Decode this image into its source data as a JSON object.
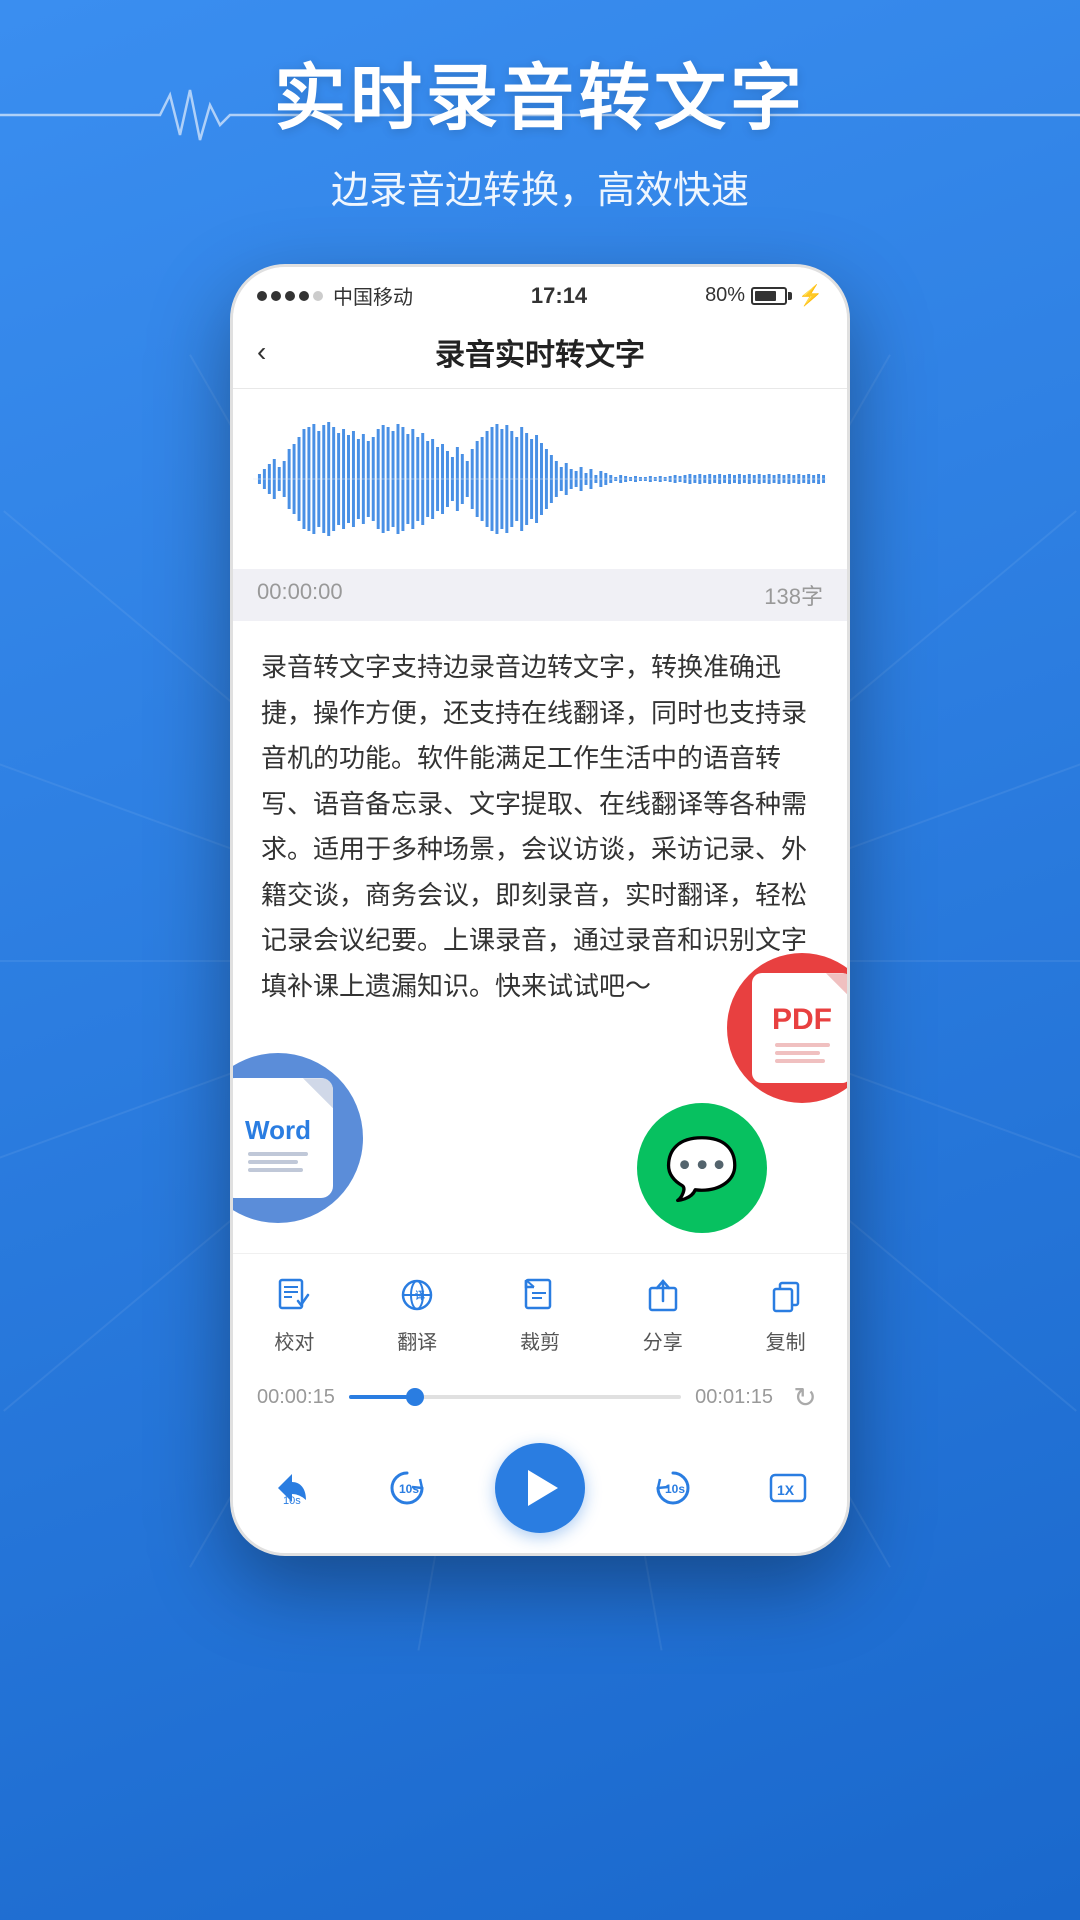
{
  "background": {
    "color_top": "#3a8ef0",
    "color_bottom": "#1a68cc"
  },
  "header": {
    "title": "实时录音转文字",
    "subtitle": "边录音边转换，高效快速"
  },
  "status_bar": {
    "signals": [
      "●",
      "●",
      "●",
      "●",
      "○"
    ],
    "carrier": "中国移动",
    "time": "17:14",
    "battery": "80%"
  },
  "nav": {
    "back_label": "‹",
    "title": "录音实时转文字"
  },
  "waveform": {
    "label": "audio-waveform"
  },
  "time_bar": {
    "elapsed": "00:00:00",
    "count": "138字"
  },
  "transcript": {
    "text": "录音转文字支持边录音边转文字，转换准确迅捷，操作方便，还支持在线翻译，同时也支持录音机的功能。软件能满足工作生活中的语音转写、语音备忘录、文字提取、在线翻译等各种需求。适用于多种场景，会议访谈，采访记录、外籍交谈，商务会议，即刻录音，实时翻译，轻松记录会议纪要。上课录音，通过录音和识别文字填补课上遗漏知识。快来试试吧～"
  },
  "toolbar": {
    "items": [
      {
        "id": "proofread",
        "label": "校对",
        "icon": "edit-check"
      },
      {
        "id": "translate",
        "label": "翻译",
        "icon": "translate"
      },
      {
        "id": "trim",
        "label": "裁剪",
        "icon": "trim"
      },
      {
        "id": "share",
        "label": "分享",
        "icon": "share"
      },
      {
        "id": "copy",
        "label": "复制",
        "icon": "copy"
      }
    ]
  },
  "progress": {
    "start_time": "00:00:15",
    "end_time": "00:01:15",
    "percent": 20
  },
  "playback": {
    "rewind_label": "",
    "rewind_seconds": "10s",
    "forward_label": "",
    "forward_seconds": "10s",
    "speed_label": "1X",
    "play_label": "play"
  },
  "badges": {
    "word": "Word",
    "pdf": "PDF",
    "wechat": "微信"
  }
}
